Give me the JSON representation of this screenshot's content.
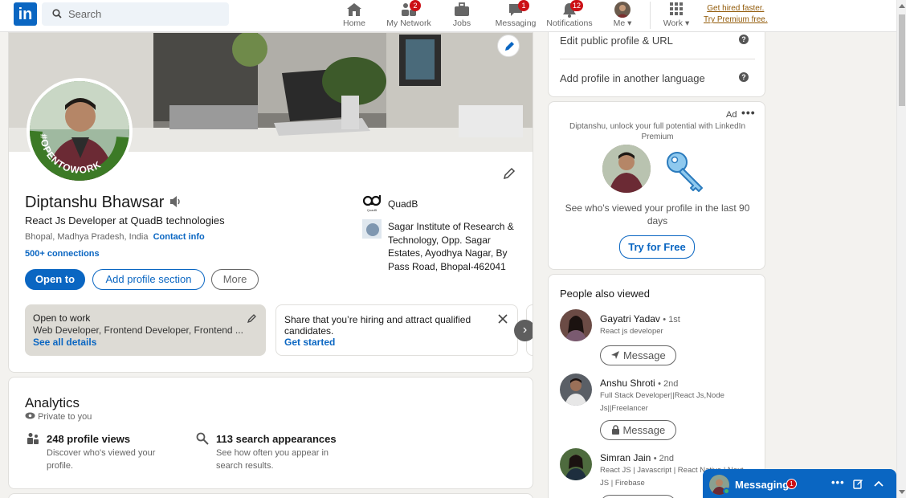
{
  "colors": {
    "accent": "#0a66c2",
    "badge": "#cc1016",
    "premium": "#915907",
    "page_bg": "#f3f2ef"
  },
  "nav": {
    "logo": "in",
    "search_placeholder": "Search",
    "items": [
      {
        "label": "Home",
        "icon": "home-icon"
      },
      {
        "label": "My Network",
        "icon": "network-icon",
        "badge": "2"
      },
      {
        "label": "Jobs",
        "icon": "briefcase-icon"
      },
      {
        "label": "Messaging",
        "icon": "chat-icon",
        "badge": "1"
      },
      {
        "label": "Notifications",
        "icon": "bell-icon",
        "badge": "12"
      },
      {
        "label": "Me",
        "icon": "avatar-icon"
      },
      {
        "label": "Work",
        "icon": "grid-icon"
      }
    ],
    "premium_line1": "Get hired faster.",
    "premium_line2": "Try Premium free."
  },
  "profile": {
    "name": "Diptanshu Bhawsar",
    "headline": "React Js Developer at QuadB technologies",
    "location": "Bhopal, Madhya Pradesh, India",
    "contact_link": "Contact info",
    "connections": "500+ connections",
    "open_to_frame": "#OPENTOWORK",
    "buttons": {
      "open_to": "Open to",
      "add_section": "Add profile section",
      "more": "More"
    },
    "company": "QuadB",
    "company_logo_text": "QuadB",
    "education": "Sagar Institute of Research & Technology, Opp. Sagar Estates, Ayodhya Nagar, By Pass Road, Bhopal-462041",
    "open_to_work": {
      "title": "Open to work",
      "roles": "Web Developer, Frontend Developer, Frontend ...",
      "link": "See all details"
    },
    "hiring": {
      "text_bold": "Share that you’re hiring",
      "text_rest": " and attract qualified candidates.",
      "link": "Get started"
    }
  },
  "analytics": {
    "title": "Analytics",
    "private": "Private to you",
    "stats": [
      {
        "title": "248 profile views",
        "sub": "Discover who's viewed your profile.",
        "icon": "people-icon"
      },
      {
        "title": "113 search appearances",
        "sub": "See how often you appear in search results.",
        "icon": "search-icon"
      }
    ]
  },
  "right": {
    "edit_public": "Edit public profile & URL",
    "add_language": "Add profile in another language",
    "ad": {
      "label": "Ad",
      "promo": "Diptanshu, unlock your full potential with LinkedIn Premium",
      "desc": "See who's viewed your profile in the last 90 days",
      "cta": "Try for Free"
    },
    "pav_title": "People also viewed",
    "people": [
      {
        "name": "Gayatri Yadav",
        "degree": "• 1st",
        "role": "React js developer",
        "button": "Message",
        "btn_icon": "send-icon"
      },
      {
        "name": "Anshu Shroti",
        "degree": "• 2nd",
        "role": "Full Stack Developer||React Js,Node Js||Freelancer",
        "button": "Message",
        "btn_icon": "lock-icon"
      },
      {
        "name": "Simran Jain",
        "degree": "• 2nd",
        "role": "React JS | Javascript | React Native | Next JS | Firebase",
        "button": "",
        "btn_icon": ""
      }
    ]
  },
  "messaging": {
    "title": "Messaging",
    "badge": "1"
  }
}
